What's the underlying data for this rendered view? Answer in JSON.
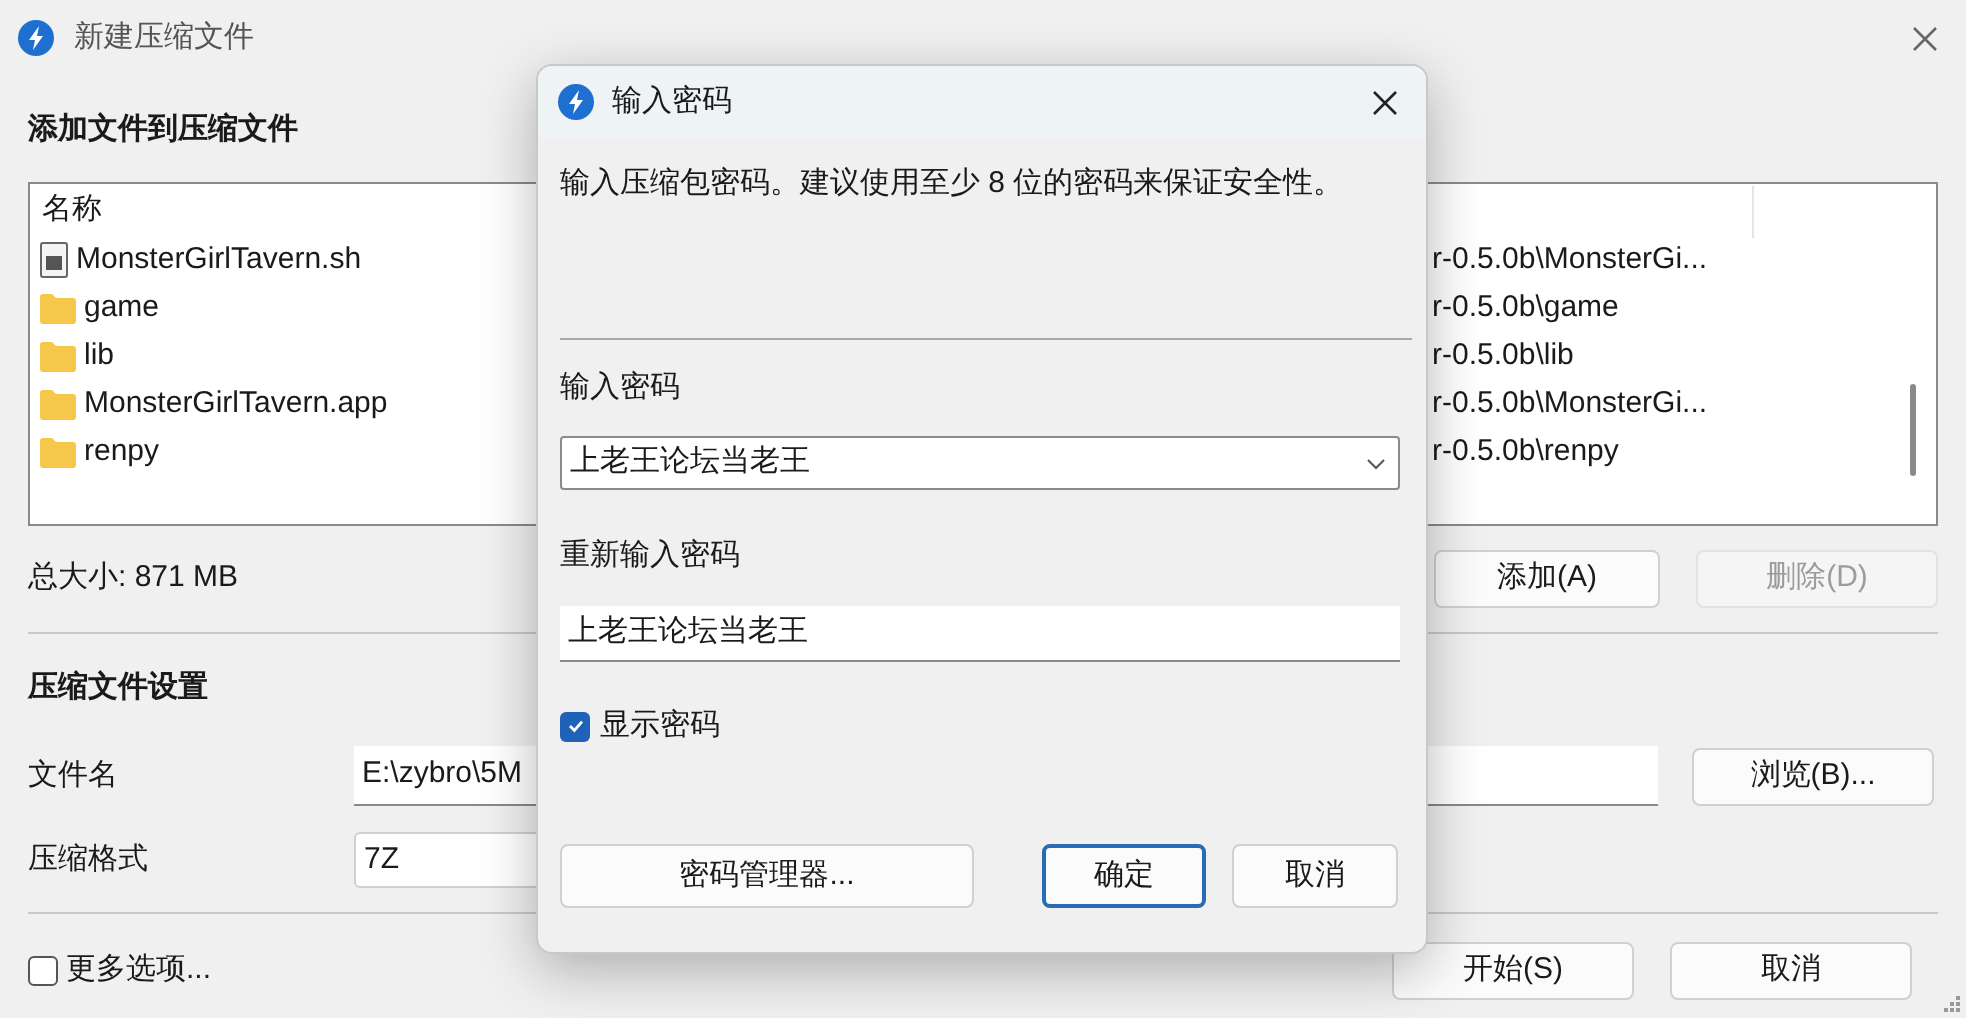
{
  "window": {
    "title": "新建压缩文件"
  },
  "files_section": {
    "heading": "添加文件到压缩文件",
    "column_1": "名称",
    "files": [
      {
        "kind": "file",
        "name": "MonsterGirlTavern.sh",
        "path": "r-0.5.0b\\MonsterGi..."
      },
      {
        "kind": "folder",
        "name": "game",
        "path": "r-0.5.0b\\game"
      },
      {
        "kind": "folder",
        "name": "lib",
        "path": "r-0.5.0b\\lib"
      },
      {
        "kind": "folder",
        "name": "MonsterGirlTavern.app",
        "path": "r-0.5.0b\\MonsterGi..."
      },
      {
        "kind": "folder",
        "name": "renpy",
        "path": "r-0.5.0b\\renpy"
      }
    ],
    "total_size": "总大小: 871 MB",
    "buttons": [
      {
        "label": "添加(A)",
        "disabled": false
      },
      {
        "label": "删除(D)",
        "disabled": true
      }
    ]
  },
  "settings": {
    "heading": "压缩文件设置",
    "file_name_label": "文件名",
    "file_name_value": "E:\\zybro\\5M",
    "browse_button": "浏览(B)...",
    "format_label": "压缩格式",
    "format_value": "7Z"
  },
  "more_options": {
    "label": "更多选项...",
    "checked": false
  },
  "footer_buttons": [
    "开始(S)",
    "取消"
  ],
  "dialog": {
    "title": "输入密码",
    "message": "输入压缩包密码。建议使用至少 8 位的密码来保证安全性。",
    "password_label": "输入密码",
    "password_value": "上老王论坛当老王",
    "confirm_label": "重新输入密码",
    "confirm_value": "上老王论坛当老王",
    "show_password": {
      "label": "显示密码",
      "checked": true
    },
    "buttons": [
      {
        "label": "密码管理器...",
        "default": false
      },
      {
        "label": "确定",
        "default": true
      },
      {
        "label": "取消",
        "default": false
      }
    ]
  }
}
